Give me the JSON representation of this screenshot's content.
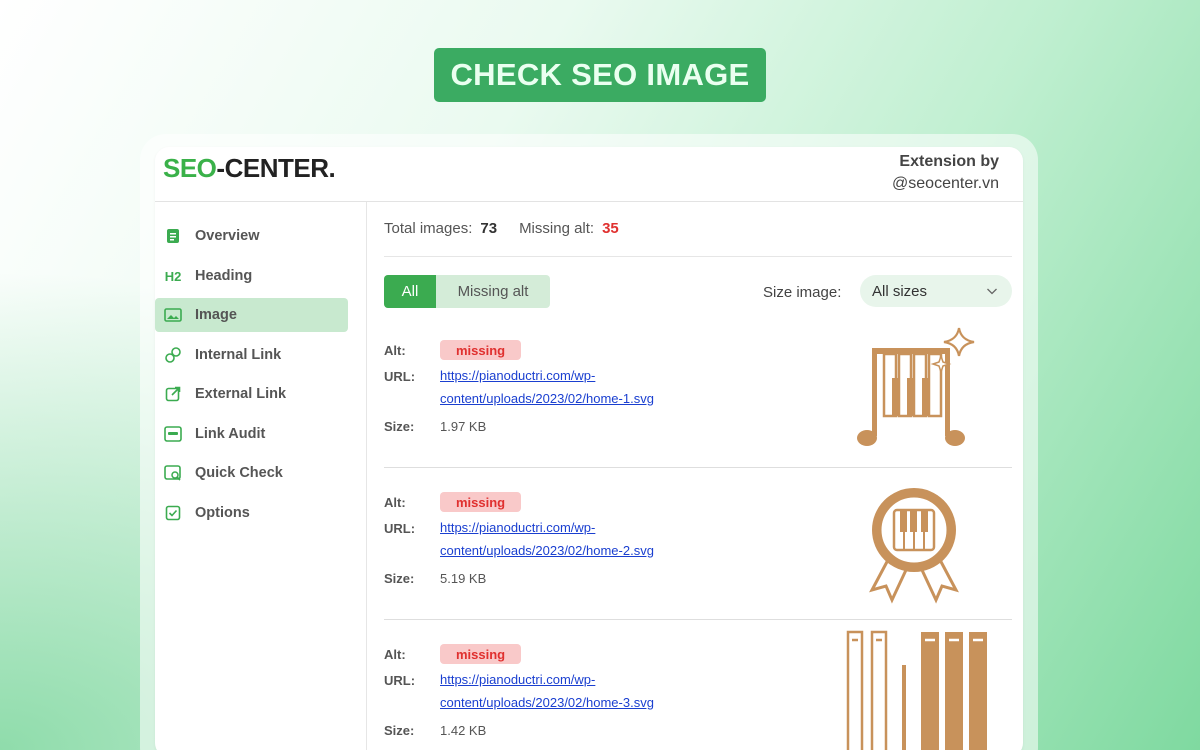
{
  "banner": {
    "title": "CHECK SEO IMAGE"
  },
  "header": {
    "logo_seo": "SEO",
    "logo_center": "-CENTER.",
    "byline_title": "Extension by",
    "byline_handle": "@seocenter.vn"
  },
  "sidebar": {
    "items": [
      {
        "label": "Overview",
        "icon": "document-icon"
      },
      {
        "label": "Heading",
        "icon": "h2-icon"
      },
      {
        "label": "Image",
        "icon": "image-icon",
        "active": true
      },
      {
        "label": "Internal Link",
        "icon": "link-icon"
      },
      {
        "label": "External Link",
        "icon": "external-link-icon"
      },
      {
        "label": "Link Audit",
        "icon": "link-audit-icon"
      },
      {
        "label": "Quick Check",
        "icon": "quick-check-icon"
      },
      {
        "label": "Options",
        "icon": "checkbox-icon"
      }
    ]
  },
  "stats": {
    "total_label": "Total images:",
    "total_value": "73",
    "missing_label": "Missing alt:",
    "missing_value": "35"
  },
  "filter": {
    "all_label": "All",
    "missing_label": "Missing alt",
    "size_label": "Size image:",
    "size_value": "All sizes"
  },
  "images": [
    {
      "alt_label": "Alt:",
      "alt_value": "missing",
      "url_label": "URL:",
      "url": "https://pianoductri.com/wp-content/uploads/2023/02/home-1.svg",
      "size_label": "Size:",
      "size": "1.97 KB",
      "thumb": "piano-music-note-icon"
    },
    {
      "alt_label": "Alt:",
      "alt_value": "missing",
      "url_label": "URL:",
      "url": "https://pianoductri.com/wp-content/uploads/2023/02/home-2.svg",
      "size_label": "Size:",
      "size": "5.19 KB",
      "thumb": "piano-award-badge-icon"
    },
    {
      "alt_label": "Alt:",
      "alt_value": "missing",
      "url_label": "URL:",
      "url": "https://pianoductri.com/wp-content/uploads/2023/02/home-3.svg",
      "size_label": "Size:",
      "size": "1.42 KB",
      "thumb": "piano-keys-icon"
    }
  ],
  "colors": {
    "accent": "#3bab50",
    "missing": "#e0302f",
    "thumb": "#c8925b"
  }
}
